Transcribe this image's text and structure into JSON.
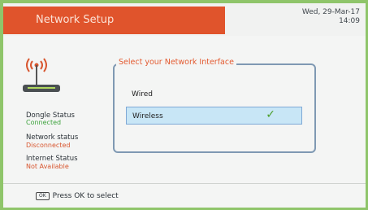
{
  "header": {
    "title": "Network Setup",
    "date": "Wed, 29-Mar-17",
    "time": "14:09"
  },
  "status": {
    "dongle_label": "Dongle Status",
    "dongle_value": "Connected",
    "network_label": "Network status",
    "network_value": "Disconnected",
    "internet_label": "Internet Status",
    "internet_value": "Not Available"
  },
  "interface_group": {
    "title": "Select your Network Interface",
    "options": [
      {
        "label": "Wired",
        "selected": false
      },
      {
        "label": "Wireless",
        "selected": true
      }
    ],
    "check_glyph": "✓"
  },
  "footer": {
    "key_label": "OK",
    "hint": "Press OK to select"
  },
  "colors": {
    "title_bar": "#e0542c",
    "frame": "#8fc56a",
    "connected": "#3da33d",
    "warning": "#d8562f",
    "selection": "#c8e6f6"
  },
  "icons": {
    "router": "wireless-router-icon",
    "check": "check-icon"
  }
}
